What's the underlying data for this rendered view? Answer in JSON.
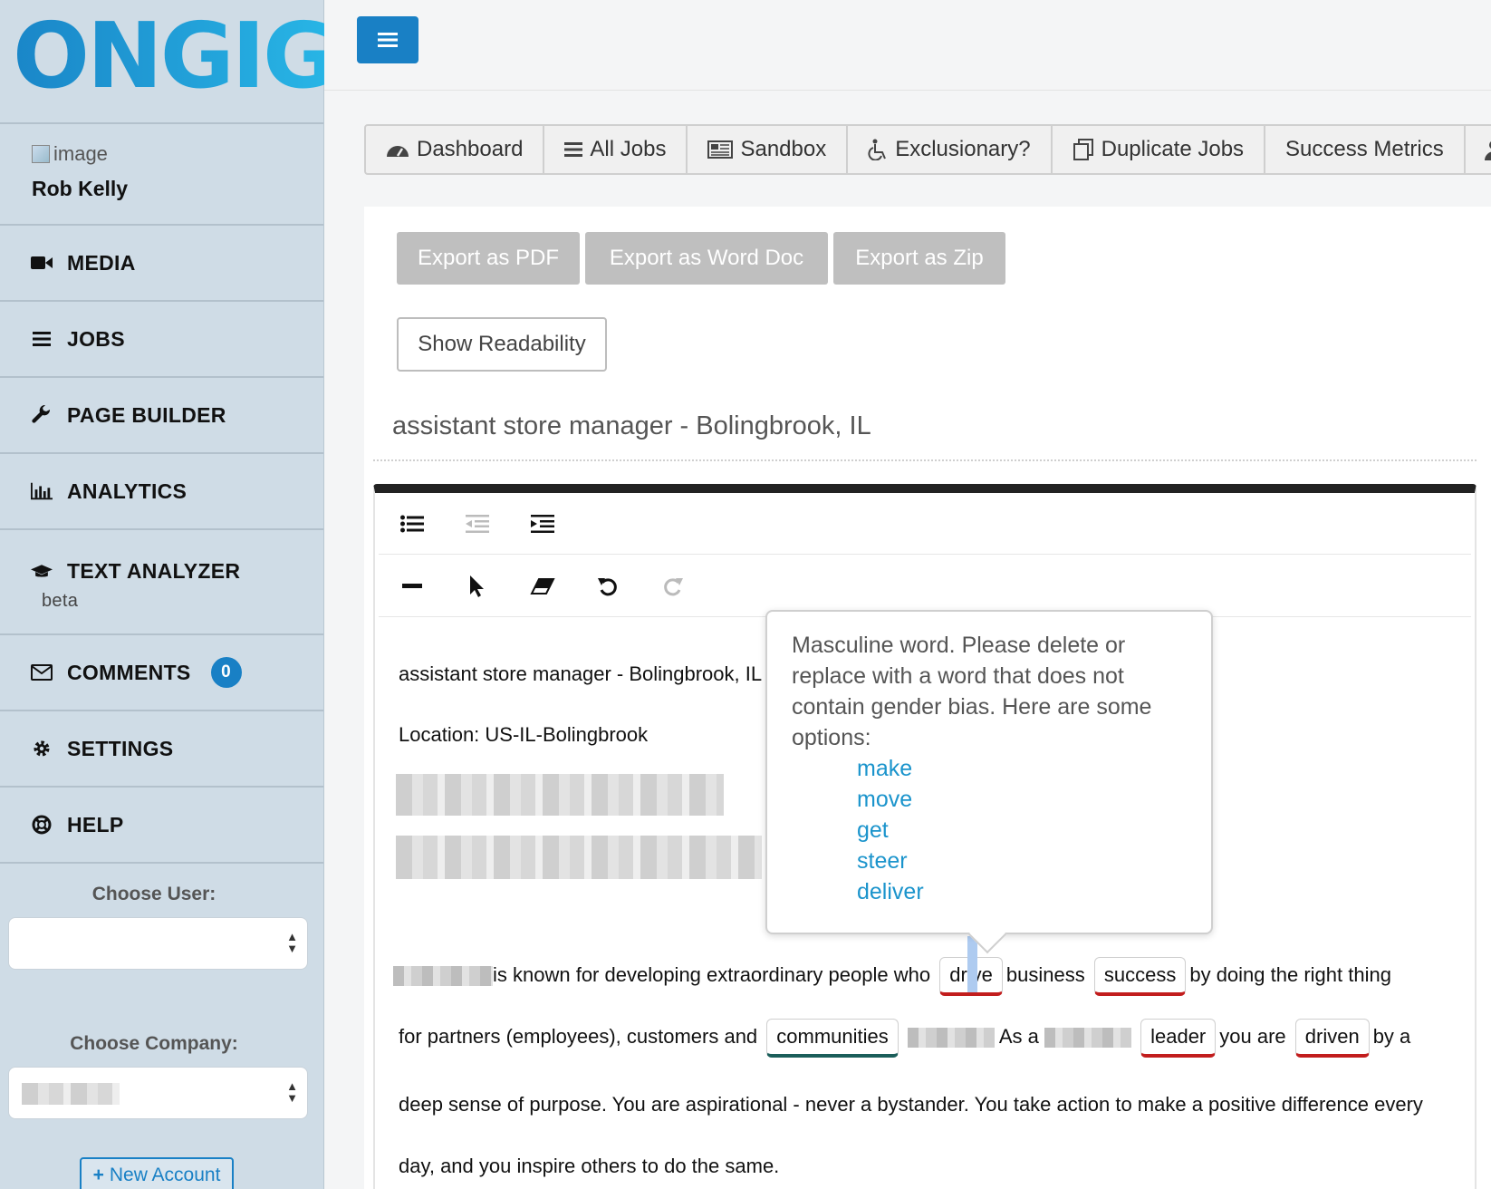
{
  "brand": {
    "logo_text": "ONGIG",
    "accent": "#1980c5"
  },
  "profile": {
    "image_alt": "image",
    "name": "Rob Kelly"
  },
  "sidebar": {
    "items": [
      {
        "label": "MEDIA",
        "icon": "video-camera-icon"
      },
      {
        "label": "JOBS",
        "icon": "list-icon"
      },
      {
        "label": "PAGE BUILDER",
        "icon": "wrench-icon"
      },
      {
        "label": "ANALYTICS",
        "icon": "bar-chart-icon"
      },
      {
        "label": "TEXT ANALYZER",
        "sub": "beta",
        "icon": "graduation-cap-icon"
      },
      {
        "label": "COMMENTS",
        "badge": "0",
        "icon": "envelope-icon"
      },
      {
        "label": "SETTINGS",
        "icon": "gear-icon"
      },
      {
        "label": "HELP",
        "icon": "life-ring-icon"
      }
    ],
    "choose_user_label": "Choose User:",
    "choose_company_label": "Choose Company:",
    "new_account_label": "New Account"
  },
  "tabs": [
    {
      "label": "Dashboard",
      "icon": "tachometer-icon"
    },
    {
      "label": "All Jobs",
      "icon": "list-icon"
    },
    {
      "label": "Sandbox",
      "icon": "newspaper-icon"
    },
    {
      "label": "Exclusionary?",
      "icon": "wheelchair-icon"
    },
    {
      "label": "Duplicate Jobs",
      "icon": "copy-icon"
    },
    {
      "label": "Success Metrics",
      "icon": ""
    }
  ],
  "toolbar": {
    "export_pdf": "Export as PDF",
    "export_word": "Export as Word Doc",
    "export_zip": "Export as Zip",
    "show_readability": "Show Readability"
  },
  "job": {
    "title": "assistant store manager - Bolingbrook, IL"
  },
  "document": {
    "line1": "assistant store manager - Bolingbrook, IL",
    "line2": "Location: US-IL-Bolingbrook",
    "p1_a": "is known for developing extraordinary people who",
    "w_drive": "drive",
    "p1_b": "business",
    "w_success": "success",
    "p1_c": "by doing the right thing",
    "p2_a": "for partners (employees), customers and",
    "w_communities": "communities",
    "p2_b": "As a",
    "w_leader": "leader",
    "p2_c": "you are",
    "w_driven": "driven",
    "p2_d": "by a",
    "p3": "deep sense of purpose. You are aspirational - never a bystander. You take action to make a positive difference every",
    "p4": "day, and you inspire others to do the same."
  },
  "tooltip": {
    "message": "Masculine word. Please delete or replace with a word that does not contain gender bias. Here are some options:",
    "options": [
      "make",
      "move",
      "get",
      "steer",
      "deliver"
    ]
  }
}
